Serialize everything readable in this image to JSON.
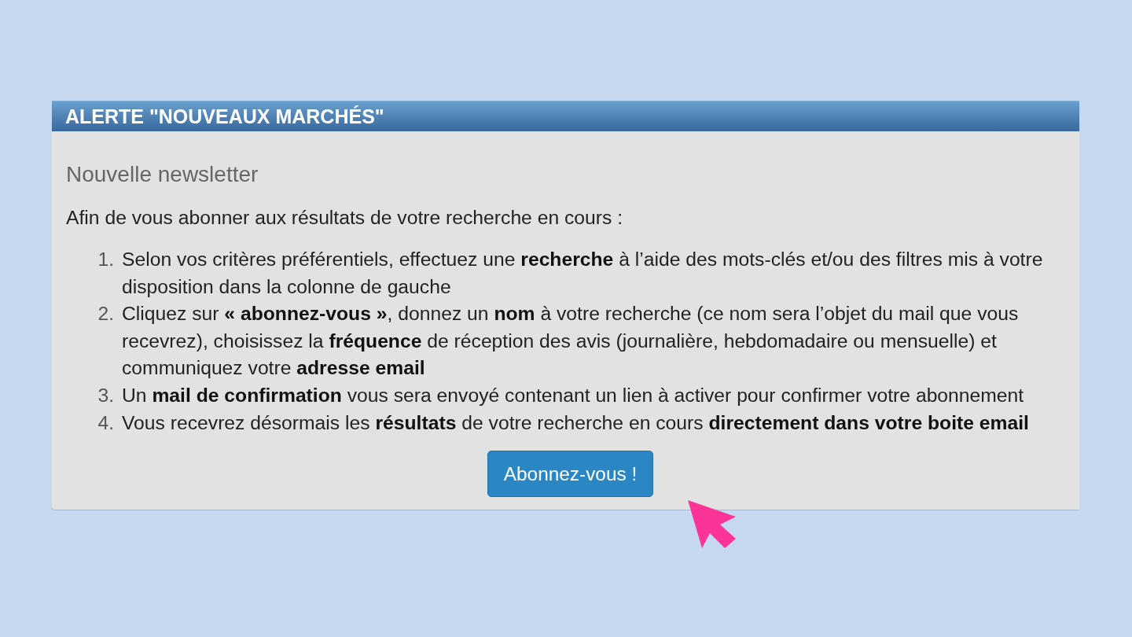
{
  "panel": {
    "title": "ALERTE \"NOUVEAUX MARCHÉS\"",
    "heading": "Nouvelle newsletter",
    "intro": "Afin de vous abonner aux résultats de votre recherche en cours :",
    "steps": [
      {
        "number": "1.",
        "text": "Selon vos critères préférentiels, effectuez une **recherche** à l’aide des mots-clés et/ou des filtres mis à votre disposition dans la colonne de gauche"
      },
      {
        "number": "2.",
        "text": "Cliquez sur **« abonnez-vous »**, donnez un **nom** à votre recherche (ce nom sera l’objet du mail que vous recevrez), choisissez la **fréquence** de réception des avis (journalière, hebdomadaire ou mensuelle) et communiquez votre **adresse email**"
      },
      {
        "number": "3.",
        "text": "Un **mail de confirmation** vous sera envoyé contenant un lien à activer pour confirmer votre abonnement"
      },
      {
        "number": "4.",
        "text": "Vous recevrez désormais les **résultats** de votre recherche en cours **directement dans votre boite email**"
      }
    ],
    "button": {
      "label": "Abonnez-vous !"
    }
  }
}
